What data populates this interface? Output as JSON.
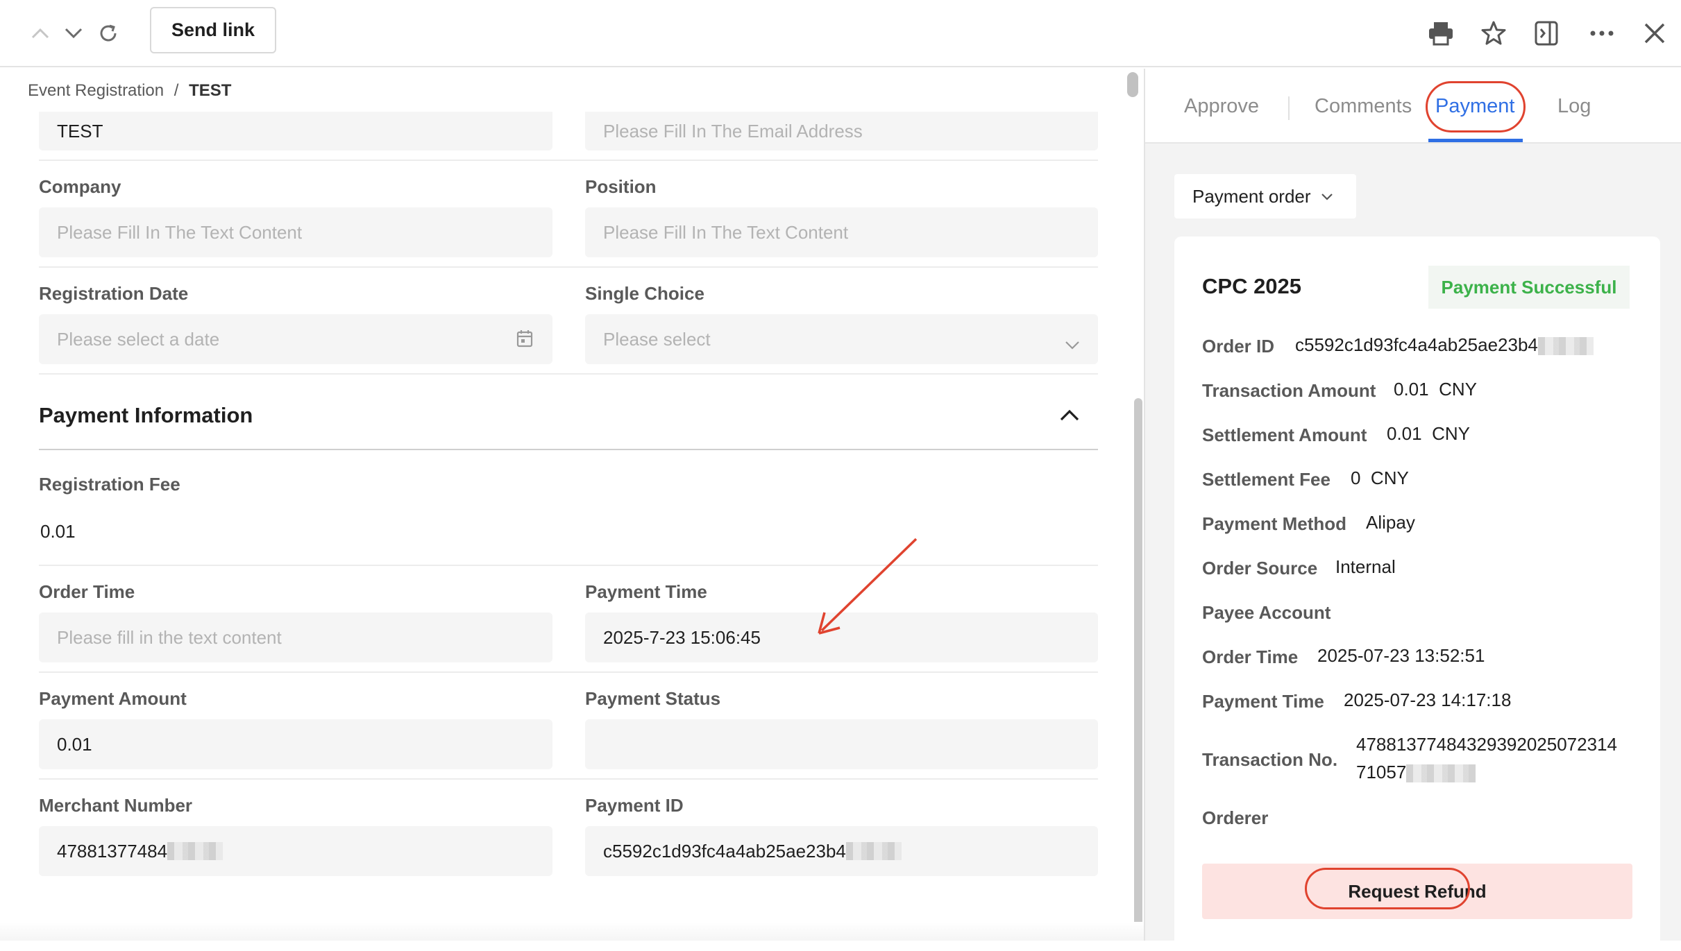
{
  "toolbar": {
    "send_link": "Send link",
    "icons": [
      "chevron-up-icon",
      "chevron-down-icon",
      "refresh-icon",
      "print-icon",
      "star-icon",
      "sidebar-toggle-icon",
      "more-icon",
      "close-icon"
    ]
  },
  "breadcrumb": {
    "parent": "Event Registration",
    "separator": "/",
    "current": "TEST"
  },
  "form": {
    "name_value": "TEST",
    "email_placeholder": "Please Fill In The Email Address",
    "company_label": "Company",
    "company_placeholder": "Please Fill In The Text Content",
    "position_label": "Position",
    "position_placeholder": "Please Fill In The Text Content",
    "regdate_label": "Registration Date",
    "regdate_placeholder": "Please select a date",
    "single_choice_label": "Single Choice",
    "single_choice_placeholder": "Please select"
  },
  "payment_section": {
    "title": "Payment Information",
    "reg_fee_label": "Registration Fee",
    "reg_fee_value": "0.01",
    "order_time_label": "Order Time",
    "order_time_placeholder": "Please fill in the text content",
    "payment_time_label": "Payment Time",
    "payment_time_value": "2025-7-23 15:06:45",
    "payment_amount_label": "Payment Amount",
    "payment_amount_value": "0.01",
    "payment_status_label": "Payment Status",
    "payment_status_value": "",
    "merchant_label": "Merchant Number",
    "merchant_value": "47881377484",
    "payment_id_label": "Payment ID",
    "payment_id_value": "c5592c1d93fc4a4ab25ae23b4"
  },
  "side": {
    "tabs": {
      "approve": "Approve",
      "comments": "Comments",
      "payment": "Payment",
      "log": "Log"
    },
    "dropdown": "Payment order",
    "card": {
      "title": "CPC 2025",
      "status": "Payment Successful",
      "order_id_label": "Order ID",
      "order_id_value": "c5592c1d93fc4a4ab25ae23b4",
      "txn_amount_label": "Transaction Amount",
      "txn_amount_value": "0.01",
      "settle_amount_label": "Settlement Amount",
      "settle_amount_value": "0.01",
      "settle_fee_label": "Settlement Fee",
      "settle_fee_value": "0",
      "currency": "CNY",
      "method_label": "Payment Method",
      "method_value": "Alipay",
      "source_label": "Order Source",
      "source_value": "Internal",
      "payee_label": "Payee Account",
      "order_time_label": "Order Time",
      "order_time_value": "2025-07-23 13:52:51",
      "pay_time_label": "Payment Time",
      "pay_time_value": "2025-07-23 14:17:18",
      "txn_no_label": "Transaction No.",
      "txn_no_line1": "47881377484329392025072314",
      "txn_no_line2": "71057",
      "orderer_label": "Orderer",
      "refund_button": "Request Refund"
    }
  },
  "colors": {
    "accent": "#2f6fe4",
    "success": "#3cb24a",
    "annotation": "#e0432f",
    "refund_bg": "#fde3e1"
  }
}
